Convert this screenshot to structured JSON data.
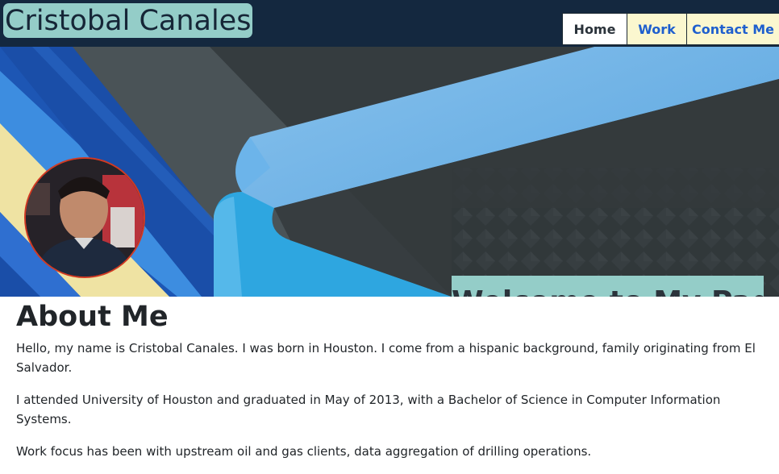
{
  "header": {
    "brand": "Cristobal Canales",
    "nav": [
      {
        "label": "Home",
        "active": true
      },
      {
        "label": "Work",
        "active": false
      },
      {
        "label": "Contact Me",
        "active": false
      }
    ]
  },
  "hero": {
    "welcome": "Welcome to My Page!"
  },
  "about": {
    "heading": "About Me",
    "paragraphs": [
      "Hello, my name is Cristobal Canales. I was born in Houston. I come from a hispanic background, family originating from El Salvador.",
      "I attended University of Houston and graduated in May of 2013, with a Bachelor of Science in Computer Information Systems.",
      "Work focus has been with upstream oil and gas clients, data aggregation of drilling operations."
    ]
  },
  "colors": {
    "header_bg": "#14283f",
    "brand_bg": "#94cdc8",
    "nav_inactive_bg": "#fbf7cf",
    "nav_link": "#1f5fce",
    "avatar_border": "#d13a23"
  }
}
